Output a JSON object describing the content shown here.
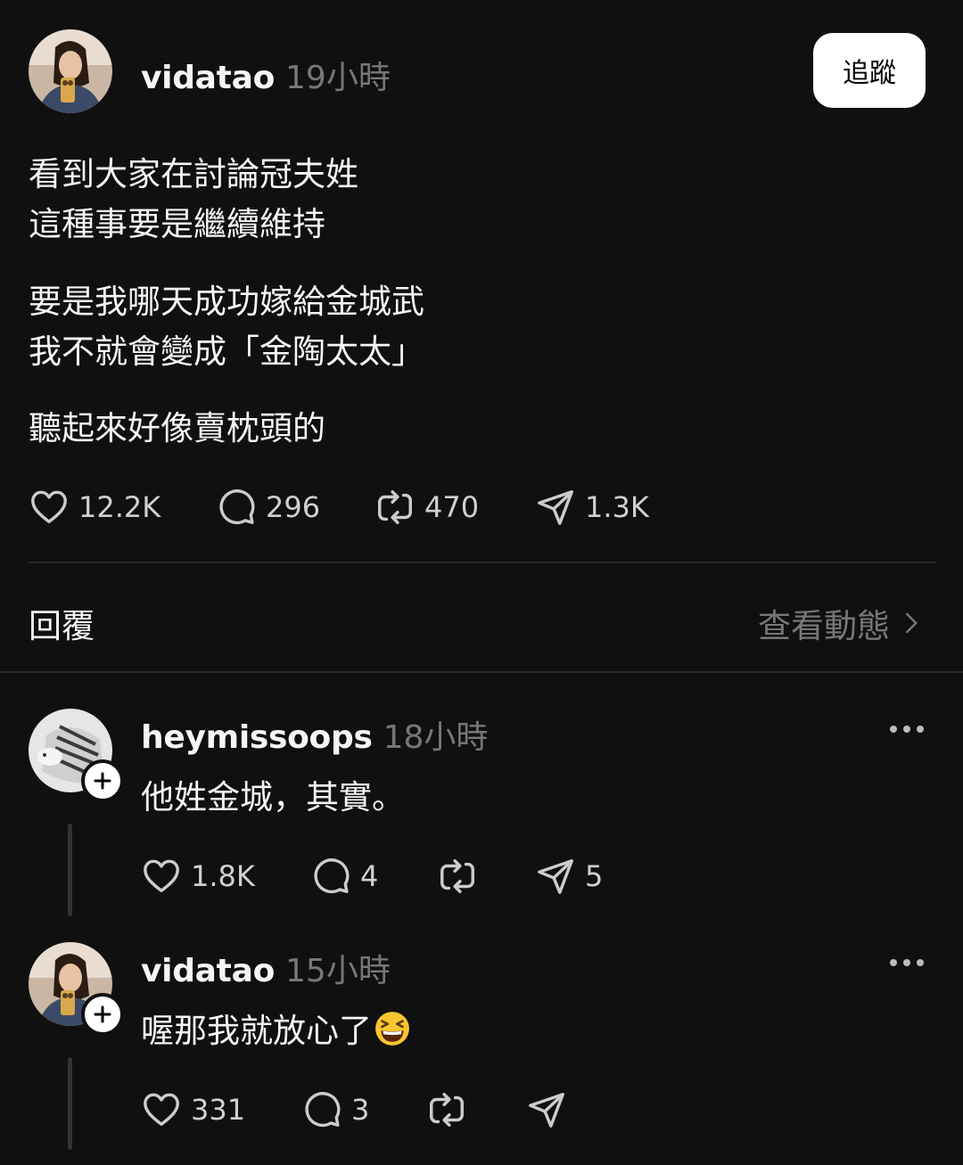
{
  "post": {
    "username": "vidatao",
    "time": "19小時",
    "follow_label": "追蹤",
    "paragraphs": [
      [
        "看到大家在討論冠夫姓",
        "這種事要是繼續維持"
      ],
      [
        "要是我哪天成功嫁給金城武",
        "我不就會變成「金陶太太」"
      ],
      [
        "聽起來好像賣枕頭的"
      ]
    ],
    "likes": "12.2K",
    "comments": "296",
    "reposts": "470",
    "shares": "1.3K"
  },
  "replies_section": {
    "label": "回覆",
    "view_activity": "查看動態"
  },
  "replies": [
    {
      "username": "heymissoops",
      "time": "18小時",
      "text": "他姓金城，其實。",
      "likes": "1.8K",
      "comments": "4",
      "reposts": "",
      "shares": "5"
    },
    {
      "username": "vidatao",
      "time": "15小時",
      "text": "喔那我就放心了",
      "emoji": "grinning-squinting-face-emoji",
      "likes": "331",
      "comments": "3",
      "reposts": "",
      "shares": ""
    }
  ],
  "icons": {
    "like": "heart-icon",
    "comment": "comment-bubble-icon",
    "repost": "repost-icon",
    "share": "send-icon",
    "more": "more-dots-icon",
    "chevron": "chevron-right-icon",
    "plus": "plus-icon"
  },
  "colors": {
    "background": "#101010",
    "text": "#f3f5f7",
    "muted": "#777777",
    "follow_button_bg": "#ffffff"
  }
}
